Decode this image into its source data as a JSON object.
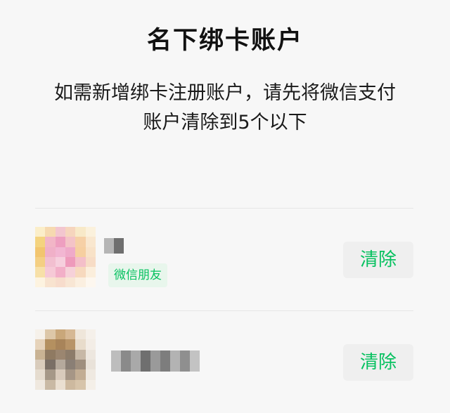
{
  "header": {
    "title": "名下绑卡账户"
  },
  "notice": {
    "line1": "如需新增绑卡注册账户，请先将微信支付",
    "line2": "账户清除到5个以下"
  },
  "accounts": [
    {
      "name": "(blurred)",
      "tag": "微信朋友",
      "action_label": "清除"
    },
    {
      "name": "(blurred)",
      "tag": "",
      "action_label": "清除"
    }
  ],
  "colors": {
    "background": "#f7f7f7",
    "accent_green": "#07c160",
    "tag_bg": "#e8f6ec",
    "button_bg": "#efefef",
    "divider": "#e6e6e6"
  }
}
